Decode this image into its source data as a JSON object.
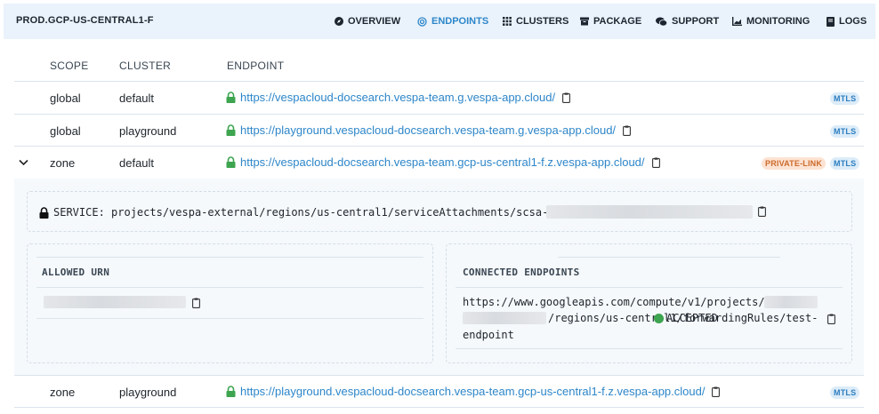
{
  "topbar": {
    "title": "PROD.GCP-US-CENTRAL1-F",
    "nav": [
      {
        "label": "OVERVIEW",
        "icon": "compass-icon"
      },
      {
        "label": "ENDPOINTS",
        "icon": "endpoints-icon",
        "active": true
      },
      {
        "label": "CLUSTERS",
        "icon": "grid-icon"
      },
      {
        "label": "PACKAGE",
        "icon": "package-icon"
      },
      {
        "label": "SUPPORT",
        "icon": "chat-icon"
      },
      {
        "label": "MONITORING",
        "icon": "chart-icon"
      },
      {
        "label": "LOGS",
        "icon": "book-icon"
      }
    ]
  },
  "table": {
    "headers": {
      "scope": "SCOPE",
      "cluster": "CLUSTER",
      "endpoint": "ENDPOINT"
    },
    "rows": [
      {
        "scope": "global",
        "cluster": "default",
        "url": "https://vespacloud-docsearch.vespa-team.g.vespa-app.cloud/",
        "badges": [
          "MTLS"
        ]
      },
      {
        "scope": "global",
        "cluster": "playground",
        "url": "https://playground.vespacloud-docsearch.vespa-team.g.vespa-app.cloud/",
        "badges": [
          "MTLS"
        ]
      },
      {
        "scope": "zone",
        "cluster": "default",
        "url": "https://vespacloud-docsearch.vespa-team.gcp-us-central1-f.z.vespa-app.cloud/",
        "badges": [
          "PRIVATE-LINK",
          "MTLS"
        ],
        "expanded": true
      },
      {
        "scope": "zone",
        "cluster": "playground",
        "url": "https://playground.vespacloud-docsearch.vespa-team.gcp-us-central1-f.z.vespa-app.cloud/",
        "badges": [
          "MTLS"
        ]
      }
    ]
  },
  "private_link": {
    "service_label": "SERVICE:",
    "service_value": "projects/vespa-external/regions/us-central1/serviceAttachments/scsa-",
    "allowed_urn_title": "ALLOWED URN",
    "connected_endpoints_title": "CONNECTED ENDPOINTS",
    "connected_line1": "https://www.googleapis.com/compute/v1/projects/",
    "connected_line2": "/regions/us-central1/forwardingRules/test-",
    "connected_line3": "endpoint",
    "connected_status": "ACCEPTED"
  },
  "colors": {
    "accent": "#2d86c9",
    "topbar_bg": "#eaf3fb",
    "lock_green": "#3da44f",
    "mtls_badge_bg": "#dcecf8",
    "private_link_badge_bg": "#fde3d3"
  }
}
